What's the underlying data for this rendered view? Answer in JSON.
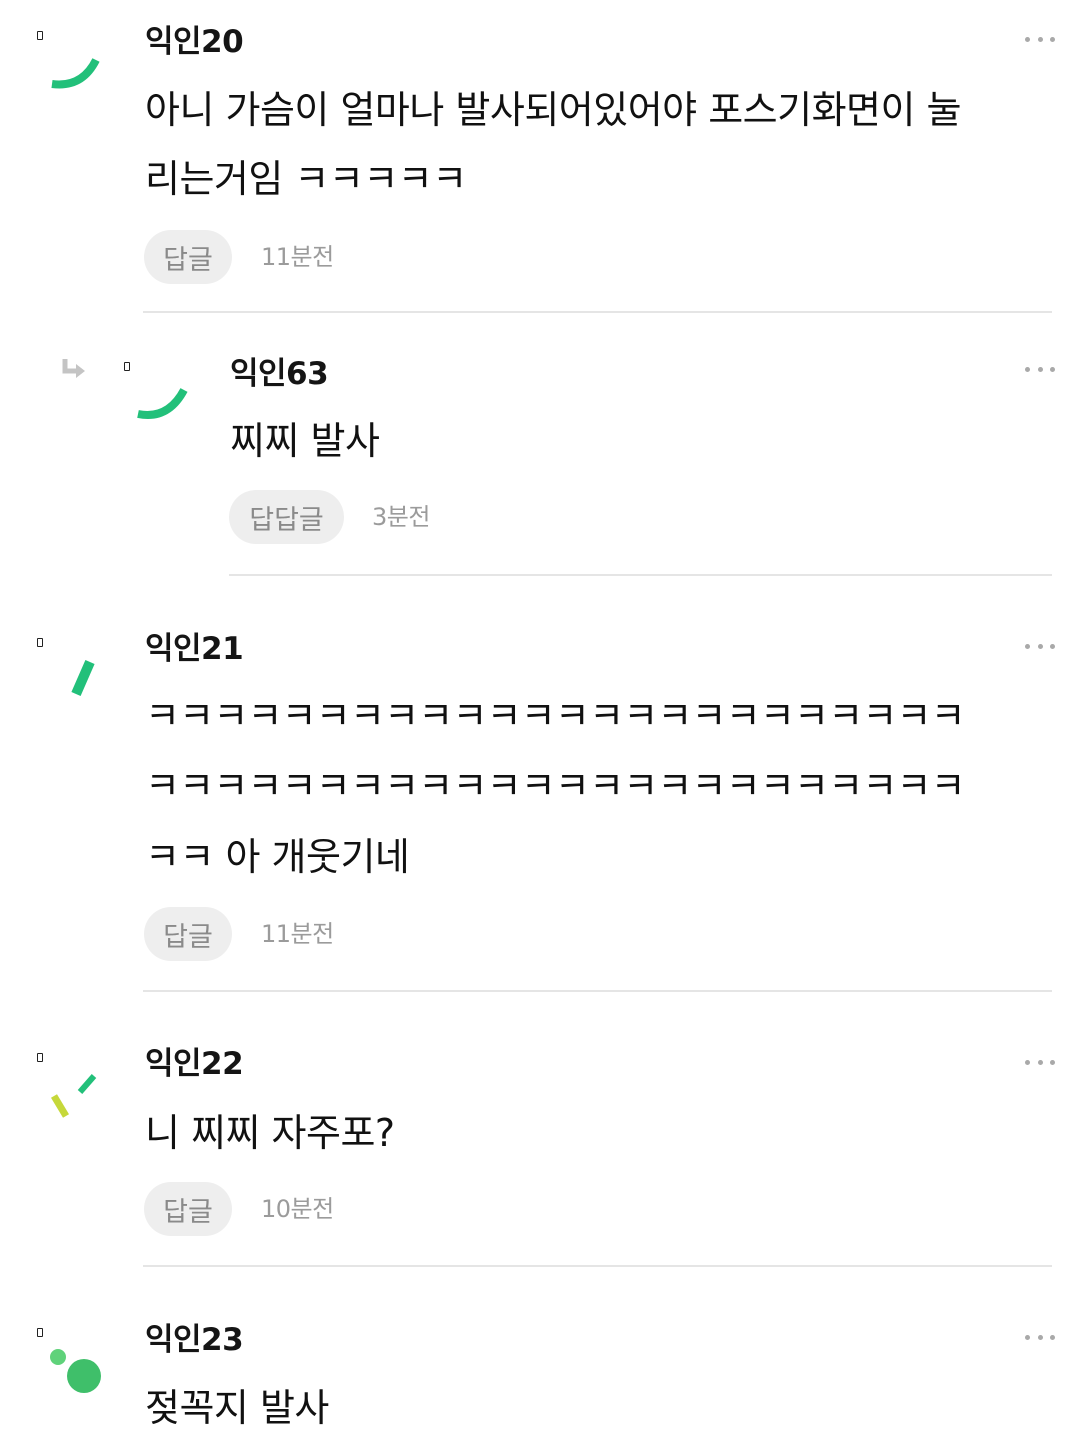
{
  "comments": [
    {
      "author": "익인20",
      "lines": [
        "아니 가슴이 얼마나 발사되어있어야 포스기화면이 눌",
        "리는거임 ㅋㅋㅋㅋㅋ"
      ],
      "reply_label": "답글",
      "time": "11분전",
      "avatar_icon": "green-arc-icon"
    },
    {
      "author": "익인63",
      "lines": [
        "찌찌 발사"
      ],
      "reply_label": "답답글",
      "time": "3분전",
      "avatar_icon": "green-arc-icon",
      "is_reply": true
    },
    {
      "author": "익인21",
      "lines": [
        "ㅋㅋㅋㅋㅋㅋㅋㅋㅋㅋㅋㅋㅋㅋㅋㅋㅋㅋㅋㅋㅋㅋㅋㅋ",
        "ㅋㅋㅋㅋㅋㅋㅋㅋㅋㅋㅋㅋㅋㅋㅋㅋㅋㅋㅋㅋㅋㅋㅋㅋ",
        "ㅋㅋ 아 개웃기네"
      ],
      "reply_label": "답글",
      "time": "11분전",
      "avatar_icon": "green-slash-icon"
    },
    {
      "author": "익인22",
      "lines": [
        "니 찌찌 자주포?"
      ],
      "reply_label": "답글",
      "time": "10분전",
      "avatar_icon": "lime-strokes-icon"
    },
    {
      "author": "익인23",
      "lines": [
        "젖꼭지 발사"
      ],
      "avatar_icon": "green-dots-icon"
    }
  ],
  "colors": {
    "accent_green": "#22c07a",
    "lime": "#c6d83a",
    "button_bg": "#eeeeee",
    "muted_text": "#9b9b9b",
    "divider": "#e5e5e5"
  },
  "icons": {
    "more": "more-dots-icon",
    "reply_arrow": "reply-arrow-icon",
    "pin": "pin-icon"
  }
}
